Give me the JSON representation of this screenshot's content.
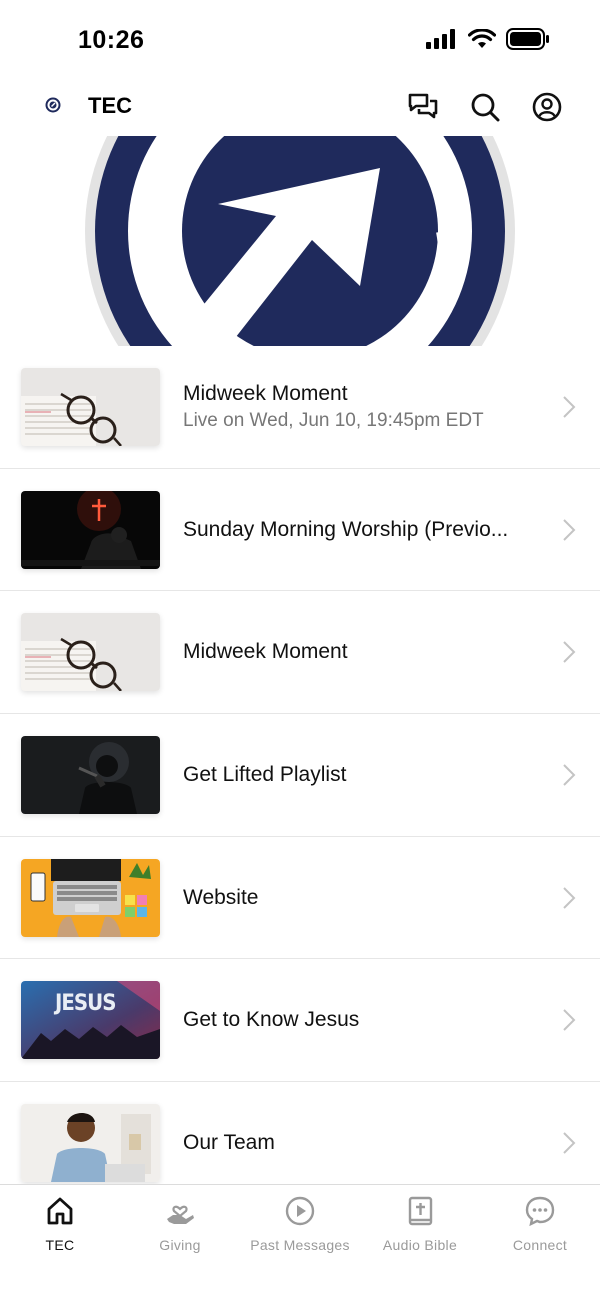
{
  "status_bar": {
    "time": "10:26"
  },
  "header": {
    "title": "TEC"
  },
  "items": [
    {
      "title": "Midweek Moment",
      "subtitle": "Live on Wed, Jun 10, 19:45pm EDT",
      "thumb": "glasses-bible"
    },
    {
      "title": "Sunday Morning Worship (Previo...",
      "thumb": "cross-silhouette"
    },
    {
      "title": "Midweek Moment",
      "thumb": "glasses-bible"
    },
    {
      "title": "Get Lifted Playlist",
      "thumb": "singer"
    },
    {
      "title": "Website",
      "thumb": "laptop"
    },
    {
      "title": "Get to Know Jesus",
      "thumb": "jesus-crowd"
    },
    {
      "title": "Our Team",
      "thumb": "person"
    }
  ],
  "tabs": [
    {
      "label": "TEC",
      "icon": "home-icon",
      "active": true
    },
    {
      "label": "Giving",
      "icon": "giving-icon"
    },
    {
      "label": "Past Messages",
      "icon": "play-icon"
    },
    {
      "label": "Audio Bible",
      "icon": "bible-icon"
    },
    {
      "label": "Connect",
      "icon": "chat-icon"
    }
  ],
  "colors": {
    "brand_navy": "#1f2a5c",
    "text_muted": "#777777",
    "tab_inactive": "#9a9a9a"
  }
}
